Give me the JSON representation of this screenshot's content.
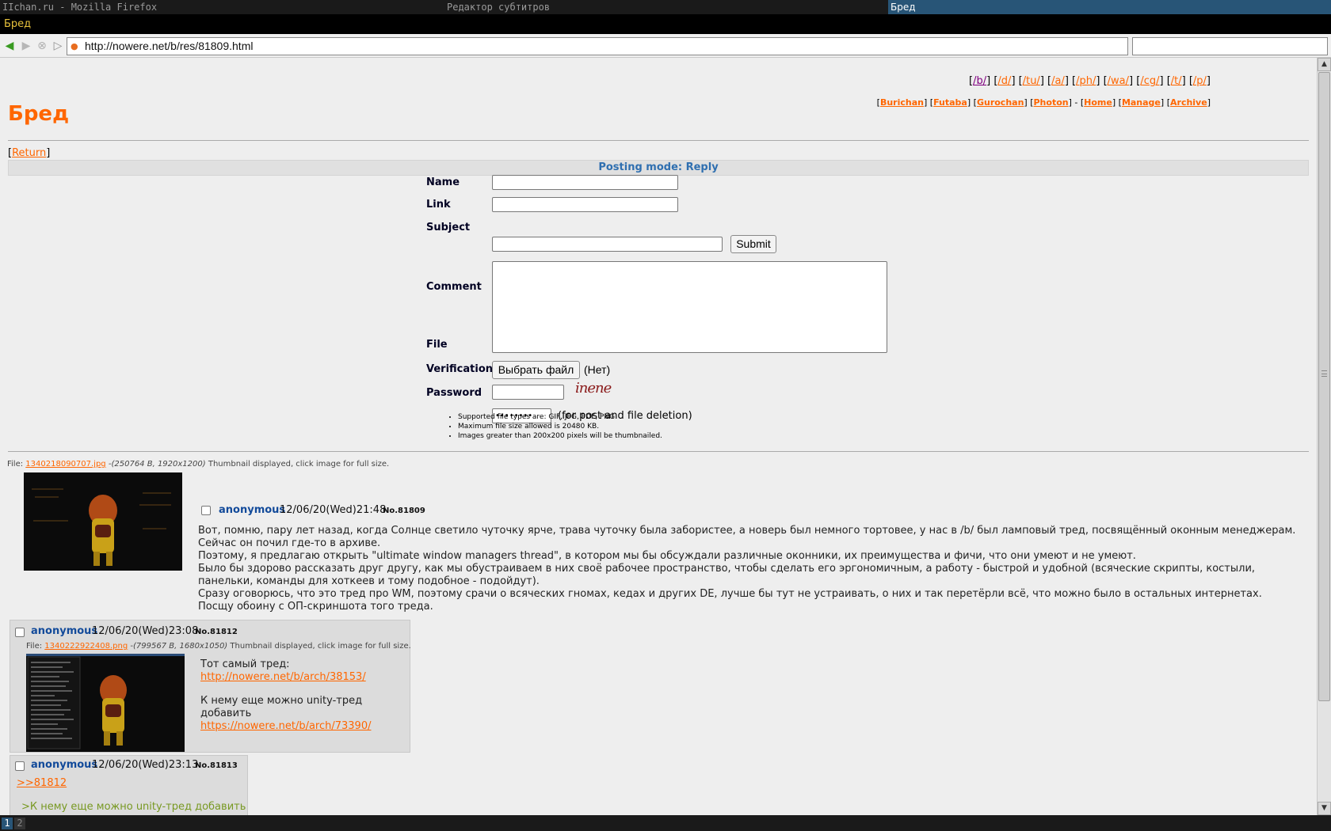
{
  "wm": {
    "segment1": "IIchan.ru - Mozilla Firefox",
    "segment2": "Редактор субтитров",
    "segment3": "Бред",
    "workspaces": [
      "1",
      "2"
    ]
  },
  "window_title": "Бред",
  "browser": {
    "url": "http://nowere.net/b/res/81809.html",
    "search_value": ""
  },
  "boards": [
    "/b/",
    "/d/",
    "/tu/",
    "/a/",
    "/ph/",
    "/wa/",
    "/cg/",
    "/t/",
    "/p/"
  ],
  "styles": [
    "Burichan",
    "Futaba",
    "Gurochan",
    "Photon"
  ],
  "nav_links": [
    "Home",
    "Manage",
    "Archive"
  ],
  "board_title": "Бред",
  "return_label": "Return",
  "posting_mode": "Posting mode: Reply",
  "form": {
    "name_label": "Name",
    "link_label": "Link",
    "subject_label": "Subject",
    "submit_label": "Submit",
    "comment_label": "Comment",
    "file_label": "File",
    "file_button": "Выбрать файл",
    "file_none": "(Нет)",
    "verification_label": "Verification",
    "captcha_text": "inene",
    "password_label": "Password",
    "password_value": "••••••••",
    "password_note": "(for post and file deletion)",
    "rules": [
      "Supported file types are: GIF, JPG, PDF, PNG",
      "Maximum file size allowed is 20480 KB.",
      "Images greater than 200x200 pixels will be thumbnailed."
    ]
  },
  "op": {
    "file_prefix": "File:",
    "file_name": "1340218090707.jpg",
    "file_meta": "-(250764 B, 1920x1200)",
    "file_note": "Thumbnail displayed, click image for full size.",
    "name": "anonymous",
    "date": "12/06/20(Wed)21:48",
    "number": "No.81809",
    "lines": [
      "Вот, помню, пару лет назад, когда Солнце светило чуточку ярче, трава чуточку была забористее, а новерь был немного тортовее, у нас в /b/ был ламповый тред, посвящённый оконным менеджерам. Сейчас он почил где-то в архиве.",
      "Поэтому, я предлагаю открыть \"ultimate window managers thread\", в котором мы бы обсуждали различные оконники, их преимущества и фичи, что они умеют и не умеют.",
      "Было бы здорово рассказать друг другу, как мы обустраиваем в них своё рабочее пространство, чтобы сделать его эргономичным, а работу - быстрой и удобной (всяческие скрипты, костыли, панельки, команды для хоткеев и тому подобное - подойдут).",
      "Сразу оговорюсь, что это тред про WM, поэтому срачи о всяческих гномах, кедах и других DE, лучше бы тут не устраивать, о них и так перетёрли всё, что можно было в остальных интернетах.",
      "Посщу обоину с ОП-скриншота того треда."
    ]
  },
  "replies": [
    {
      "name": "anonymous",
      "date": "12/06/20(Wed)23:08",
      "number": "No.81812",
      "file_prefix": "File:",
      "file_name": "1340222922408.png",
      "file_meta": "-(799567 B, 1680x1050)",
      "file_note": "Thumbnail displayed, click image for full size.",
      "line1": "Тот самый тред:",
      "link1": "http://nowere.net/b/arch/38153/",
      "line2a": "К нему еще можно unity-тред",
      "line2b": "добавить",
      "link2": "https://nowere.net/b/arch/73390/"
    },
    {
      "name": "anonymous",
      "date": "12/06/20(Wed)23:13",
      "number": "No.81813",
      "reflink": ">>81812",
      "quote": ">К нему еще можно unity-тред добавить"
    }
  ]
}
